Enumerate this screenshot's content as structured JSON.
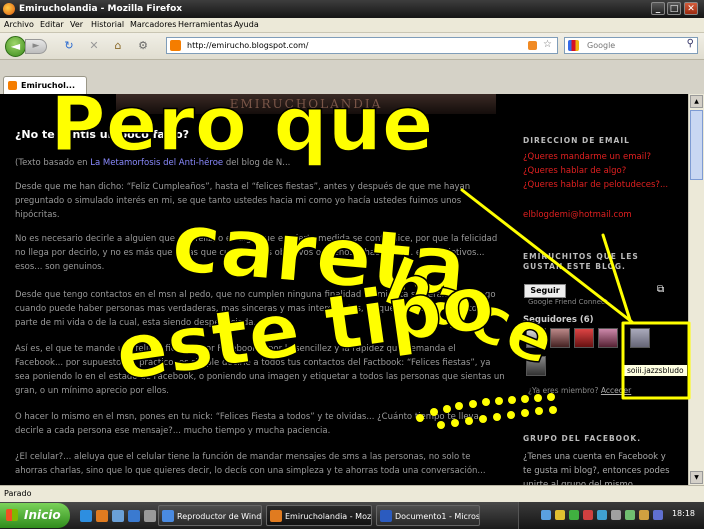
{
  "window": {
    "title": "Emirucholandia - Mozilla Firefox",
    "controls": [
      "_",
      "□",
      "✕"
    ]
  },
  "menu": [
    "Archivo",
    "Editar",
    "Ver",
    "Historial",
    "Marcadores",
    "Herramientas",
    "Ayuda"
  ],
  "address_bar": {
    "url": "http://emirucho.blogspot.com/"
  },
  "search_bar": {
    "placeholder": "Google"
  },
  "tab": {
    "label": "Emiruchol..."
  },
  "page": {
    "banner": "EMIRUCHOLANDIA",
    "post_title": "¿No te sentís un poco falso?",
    "paragraphs": [
      {
        "pre": "(Texto basado en ",
        "link": "La Metamorfosis del Anti-héroe",
        "post": " del blog de N..."
      },
      {
        "text": "Desde que me han dicho: “Feliz Cumpleaños”, hasta el “felices fiestas”, antes y después de que me hayan preguntado o simulado interés en mi, se que tanto ustedes hacia mi como yo hacía ustedes fuimos unos hipócritas."
      },
      {
        "text": "No es necesario decirle a alguien que sea feliz, o es algo que en cierta medida se contradice, por que la felicidad no llega por decirlo, y no es más que digas que cumplen tus objetivos o sueños o hace feliz... esos objetivos... esos... son genuinos."
      },
      {
        "text": "Desde que tengo contactos en el msn al pedo, que no cumplen ninguna finalidad en mi lista sinceramente luego cuando puede haber personas mas verdaderas, mas sinceras y mas interesantes, se que en estos momentos parte de mi vida o de la cual, esta siendo desperdiciada."
      },
      {
        "text": "Así es, el que te mande un “felices fiestas” por Facebook... por la sencillez y la rapidez que demanda el Facebook... por supuesto, es práctico, es simple decirle a todos tus contactos del Factbook: “Felices fiestas”, ya sea poniendo lo en el estado de Facebook, o poniendo una imagen y etiquetar a todos las personas que sientas un gran, o un mínimo aprecio por ellos."
      },
      {
        "text": "O hacer lo mismo en el msn, pones en tu nick: “Felices Fiesta a todos” y te olvidas... ¿Cuánto tiempo te lleva decirle a cada persona ese mensaje?... mucho tiempo y mucha paciencia."
      },
      {
        "text": "¿El celular?... aleluya que el celular tiene la función de mandar mensajes de sms a las personas, no solo te ahorras charlas, sino que lo que quieres decir, lo decís con una simpleza y te ahorras toda una conversación..."
      }
    ]
  },
  "sidebar": {
    "email_heading": "DIRECCION DE EMAIL",
    "email_links": [
      "¿Queres mandarme un email?",
      "¿Queres hablar de algo?",
      "¿Queres hablar de pelotudeces?..."
    ],
    "email_address": "elblogdemi@hotmail.com",
    "followers_heading": "EMIRUCHITOS QUE LES GUSTAN ESTE BLOG.",
    "follow_button": "Seguir",
    "follow_sub": "Google Friend Connect",
    "followers_label": "Seguidores (6)",
    "tooltip": "soiii.jazzsbludo",
    "member_text": "¿Ya eres miembro?",
    "member_link": "Acceder",
    "group_heading": "GRUPO DEL FACEBOOK.",
    "group_text": "¿Tenes una cuenta en Facebook y te gusta mi blog?, entonces podes unirte al grupo del mismo..."
  },
  "status": {
    "text": "Parado"
  },
  "taskbar": {
    "start": "Inicio",
    "tasks": [
      "Reproductor de Wind...",
      "Emirucholandia - Mozil...",
      "Documento1 - Micros..."
    ],
    "clock": "18:18"
  },
  "handwriting": [
    "Pero que",
    "careta",
    "hace",
    "este tipo"
  ],
  "colors": {
    "scribble": "#ffff00",
    "link_red": "#e02020",
    "page_bg": "#000000",
    "body_text": "#9a9a9a"
  }
}
